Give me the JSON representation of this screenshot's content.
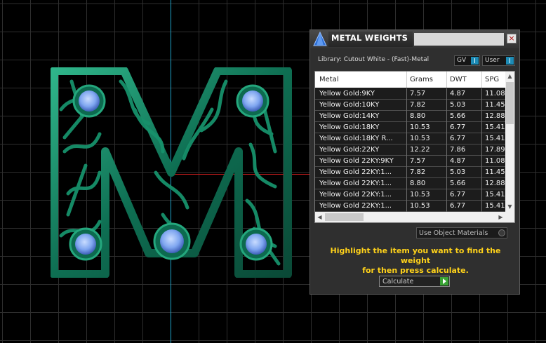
{
  "panel": {
    "title": "METAL WEIGHTS",
    "close_glyph": "×",
    "library_label": "Library: Cutout White - (Fast)-Metal",
    "toggle_gv": "GV",
    "toggle_user": "User",
    "columns": [
      "Metal",
      "Grams",
      "DWT",
      "SPG"
    ],
    "rows": [
      [
        "Yellow Gold:9KY",
        "7.57",
        "4.87",
        "11.08"
      ],
      [
        "Yellow Gold:10KY",
        "7.82",
        "5.03",
        "11.45"
      ],
      [
        "Yellow Gold:14KY",
        "8.80",
        "5.66",
        "12.88"
      ],
      [
        "Yellow Gold:18KY",
        "10.53",
        "6.77",
        "15.41"
      ],
      [
        "Yellow Gold:18KY R...",
        "10.53",
        "6.77",
        "15.41"
      ],
      [
        "Yellow Gold:22KY",
        "12.22",
        "7.86",
        "17.89"
      ],
      [
        "Yellow Gold 22KY:9KY",
        "7.57",
        "4.87",
        "11.08"
      ],
      [
        "Yellow Gold 22KY:1...",
        "7.82",
        "5.03",
        "11.45"
      ],
      [
        "Yellow Gold 22KY:1...",
        "8.80",
        "5.66",
        "12.88"
      ],
      [
        "Yellow Gold 22KY:1...",
        "10.53",
        "6.77",
        "15.41"
      ],
      [
        "Yellow Gold 22KY:1...",
        "10.53",
        "6.77",
        "15.41"
      ]
    ],
    "materials_dropdown": "Use Object Materials",
    "help_line1": "Highlight the item you want to find the weight",
    "help_line2": "for then press calculate.",
    "calculate_label": "Calculate"
  },
  "icons": [
    "app-logo-icon",
    "close-icon",
    "scroll-up-icon",
    "scroll-down-icon",
    "scroll-left-icon",
    "scroll-right-icon",
    "play-icon",
    "gem-icon"
  ],
  "colors": {
    "model_green": "#0f7a5b",
    "gem_blue": "#7fa6f0",
    "help_text": "#ffd21a",
    "axis_blue": "#1fa3c9",
    "axis_red": "#c11b1b"
  }
}
